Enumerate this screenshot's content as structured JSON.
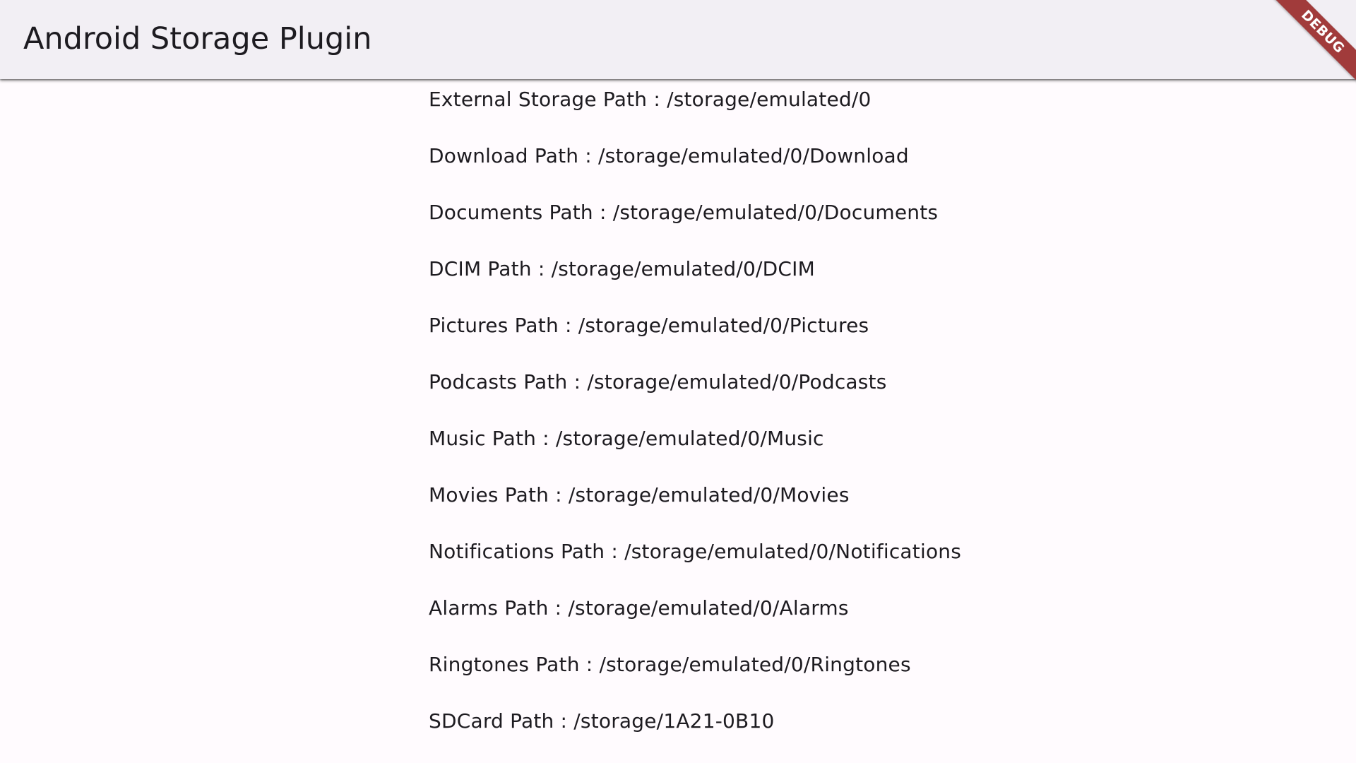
{
  "app_bar": {
    "title": "Android Storage Plugin"
  },
  "debug_banner": {
    "label": "DEBUG",
    "color": "#a13b3b"
  },
  "paths": [
    {
      "label": "External Storage Path : /storage/emulated/0"
    },
    {
      "label": "Download Path : /storage/emulated/0/Download"
    },
    {
      "label": "Documents Path : /storage/emulated/0/Documents"
    },
    {
      "label": "DCIM Path : /storage/emulated/0/DCIM"
    },
    {
      "label": "Pictures Path : /storage/emulated/0/Pictures"
    },
    {
      "label": "Podcasts Path : /storage/emulated/0/Podcasts"
    },
    {
      "label": "Music Path : /storage/emulated/0/Music"
    },
    {
      "label": "Movies Path : /storage/emulated/0/Movies"
    },
    {
      "label": "Notifications Path : /storage/emulated/0/Notifications"
    },
    {
      "label": "Alarms Path : /storage/emulated/0/Alarms"
    },
    {
      "label": "Ringtones Path : /storage/emulated/0/Ringtones"
    },
    {
      "label": "SDCard Path : /storage/1A21-0B10"
    }
  ],
  "colors": {
    "app_bar_background": "#f2eff4",
    "page_background": "#fffbfe",
    "text": "#1d1b20"
  }
}
